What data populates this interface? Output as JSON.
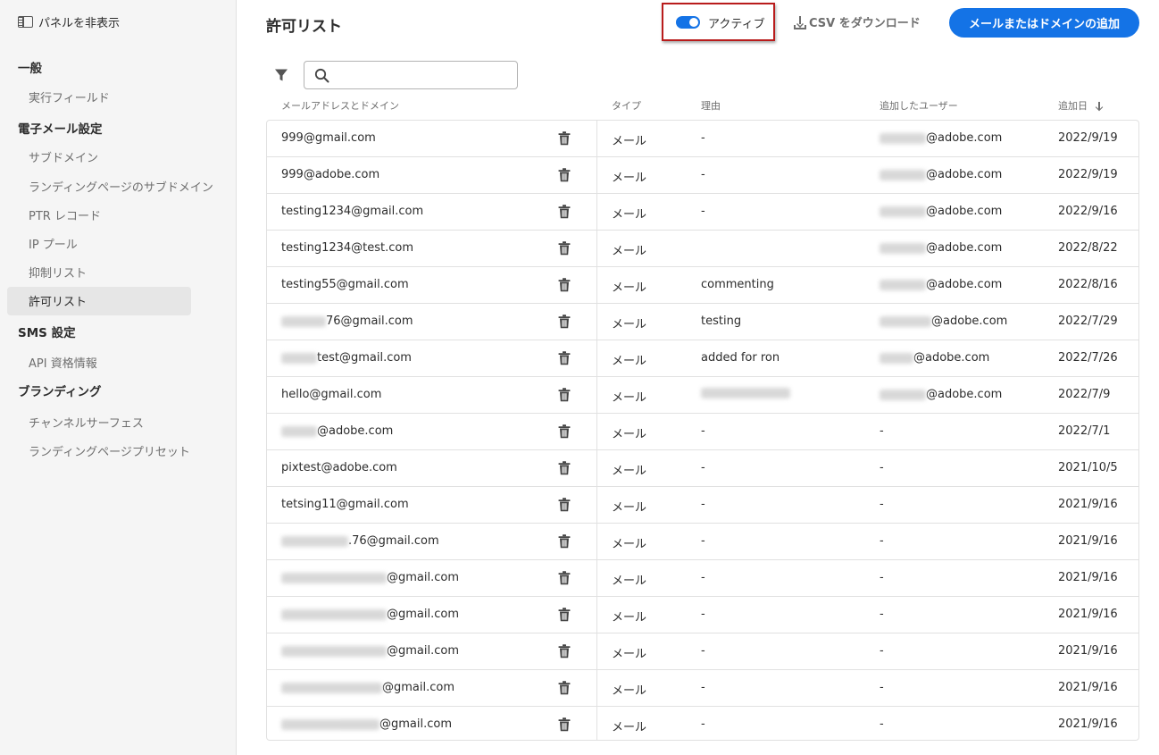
{
  "sidebar": {
    "hide_panel": "パネルを非表示",
    "general": "一般",
    "exec_fields": "実行フィールド",
    "email_settings": "電子メール設定",
    "subdomains": "サブドメイン",
    "landing_subdomains": "ランディングページのサブドメイン",
    "ptr_records": "PTR レコード",
    "ip_pool": "IP プール",
    "suppression_list": "抑制リスト",
    "allow_list": "許可リスト",
    "sms_settings": "SMS 設定",
    "api_credentials": "API 資格情報",
    "branding": "ブランディング",
    "channel_surface": "チャンネルサーフェス",
    "landing_preset": "ランディングページプリセット"
  },
  "header": {
    "title": "許可リスト",
    "toggle_label": "アクティブ",
    "toggle_on": true,
    "csv_label": "CSV をダウンロード",
    "add_label": "メールまたはドメインの追加"
  },
  "search": {
    "placeholder": "",
    "value": ""
  },
  "table": {
    "columns": {
      "email": "メールアドレスとドメイン",
      "type": "タイプ",
      "reason": "理由",
      "user": "追加したユーザー",
      "date": "追加日"
    },
    "rows": [
      {
        "email": "999@gmail.com",
        "type": "メール",
        "reason": "-",
        "user": "@adobe.com",
        "date": "2022/9/19"
      },
      {
        "email": "999@adobe.com",
        "type": "メール",
        "reason": "-",
        "user": "@adobe.com",
        "date": "2022/9/19"
      },
      {
        "email": "testing1234@gmail.com",
        "type": "メール",
        "reason": "-",
        "user": "@adobe.com",
        "date": "2022/9/16"
      },
      {
        "email": "testing1234@test.com",
        "type": "メール",
        "reason": "",
        "user": "@adobe.com",
        "date": "2022/8/22"
      },
      {
        "email": "testing55@gmail.com",
        "type": "メール",
        "reason": "commenting",
        "user": "@adobe.com",
        "date": "2022/8/16"
      },
      {
        "email": "76@gmail.com",
        "type": "メール",
        "reason": "testing",
        "user": "@adobe.com",
        "date": "2022/7/29"
      },
      {
        "email": "test@gmail.com",
        "type": "メール",
        "reason": "added for ron",
        "user": "@adobe.com",
        "date": "2022/7/26"
      },
      {
        "email": "hello@gmail.com",
        "type": "メール",
        "reason": "",
        "user": "@adobe.com",
        "date": "2022/7/9"
      },
      {
        "email": "@adobe.com",
        "type": "メール",
        "reason": "-",
        "user": "-",
        "date": "2022/7/1"
      },
      {
        "email": "pixtest@adobe.com",
        "type": "メール",
        "reason": "-",
        "user": "-",
        "date": "2021/10/5"
      },
      {
        "email": "tetsing11@gmail.com",
        "type": "メール",
        "reason": "-",
        "user": "-",
        "date": "2021/9/16"
      },
      {
        "email": ".76@gmail.com",
        "type": "メール",
        "reason": "-",
        "user": "-",
        "date": "2021/9/16"
      },
      {
        "email": "@gmail.com",
        "type": "メール",
        "reason": "-",
        "user": "-",
        "date": "2021/9/16"
      },
      {
        "email": "@gmail.com",
        "type": "メール",
        "reason": "-",
        "user": "-",
        "date": "2021/9/16"
      },
      {
        "email": "@gmail.com",
        "type": "メール",
        "reason": "-",
        "user": "-",
        "date": "2021/9/16"
      },
      {
        "email": "@gmail.com",
        "type": "メール",
        "reason": "-",
        "user": "-",
        "date": "2021/9/16"
      },
      {
        "email": "@gmail.com",
        "type": "メール",
        "reason": "-",
        "user": "-",
        "date": "2021/9/16"
      }
    ]
  },
  "colors": {
    "accent": "#1473e6",
    "highlight": "#b91c1c"
  }
}
